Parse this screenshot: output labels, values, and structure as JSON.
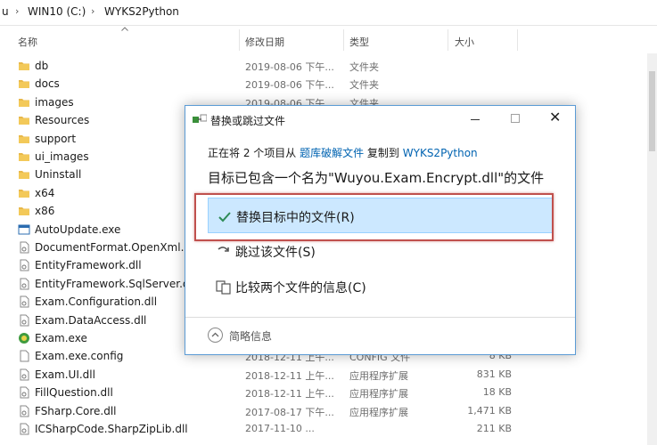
{
  "breadcrumb": {
    "items": [
      "u",
      "WIN10 (C:)",
      "WYKS2Python"
    ]
  },
  "columns": {
    "name": "名称",
    "date": "修改日期",
    "type": "类型",
    "size": "大小"
  },
  "files": [
    {
      "name": "db",
      "date": "2019-08-06 下午...",
      "type": "文件夹",
      "size": "",
      "icon": "folder-icon"
    },
    {
      "name": "docs",
      "date": "2019-08-06 下午...",
      "type": "文件夹",
      "size": "",
      "icon": "folder-icon"
    },
    {
      "name": "images",
      "date": "2019-08-06 下午...",
      "type": "文件夹",
      "size": "",
      "icon": "folder-icon"
    },
    {
      "name": "Resources",
      "date": "",
      "type": "",
      "size": "",
      "icon": "folder-icon"
    },
    {
      "name": "support",
      "date": "",
      "type": "",
      "size": "",
      "icon": "folder-icon"
    },
    {
      "name": "ui_images",
      "date": "",
      "type": "",
      "size": "",
      "icon": "folder-icon"
    },
    {
      "name": "Uninstall",
      "date": "",
      "type": "",
      "size": "",
      "icon": "folder-icon"
    },
    {
      "name": "x64",
      "date": "",
      "type": "",
      "size": "",
      "icon": "folder-icon"
    },
    {
      "name": "x86",
      "date": "",
      "type": "",
      "size": "",
      "icon": "folder-icon"
    },
    {
      "name": "AutoUpdate.exe",
      "date": "",
      "type": "",
      "size": "",
      "icon": "exe-icon"
    },
    {
      "name": "DocumentFormat.OpenXml.dll",
      "date": "",
      "type": "",
      "size": "",
      "icon": "dll-icon"
    },
    {
      "name": "EntityFramework.dll",
      "date": "",
      "type": "",
      "size": "",
      "icon": "dll-icon"
    },
    {
      "name": "EntityFramework.SqlServer.dll",
      "date": "",
      "type": "",
      "size": "",
      "icon": "dll-icon"
    },
    {
      "name": "Exam.Configuration.dll",
      "date": "",
      "type": "",
      "size": "",
      "icon": "dll-icon"
    },
    {
      "name": "Exam.DataAccess.dll",
      "date": "",
      "type": "",
      "size": "",
      "icon": "dll-icon"
    },
    {
      "name": "Exam.exe",
      "date": "",
      "type": "",
      "size": "",
      "icon": "exam-app-icon"
    },
    {
      "name": "Exam.exe.config",
      "date": "2018-12-11 上午...",
      "type": "CONFIG 文件",
      "size": "8 KB",
      "icon": "config-file-icon"
    },
    {
      "name": "Exam.UI.dll",
      "date": "2018-12-11 上午...",
      "type": "应用程序扩展",
      "size": "831 KB",
      "icon": "dll-icon"
    },
    {
      "name": "FillQuestion.dll",
      "date": "2018-12-11 上午...",
      "type": "应用程序扩展",
      "size": "18 KB",
      "icon": "dll-icon"
    },
    {
      "name": "FSharp.Core.dll",
      "date": "2017-08-17 下午...",
      "type": "应用程序扩展",
      "size": "1,471 KB",
      "icon": "dll-icon"
    },
    {
      "name": "ICSharpCode.SharpZipLib.dll",
      "date": "2017-11-10 ...",
      "type": "",
      "size": "211 KB",
      "icon": "dll-icon"
    }
  ],
  "dialog": {
    "title": "替换或跳过文件",
    "close_glyph": "✕",
    "info": {
      "prefix": "正在将 2 个项目从 ",
      "source": "题库破解文件",
      "middle": " 复制到 ",
      "dest": "WYKS2Python"
    },
    "heading": "目标已包含一个名为\"Wuyou.Exam.Encrypt.dll\"的文件",
    "options": {
      "replace": "替换目标中的文件(R)",
      "skip": "跳过该文件(S)",
      "compare": "比较两个文件的信息(C)"
    },
    "details": "简略信息"
  },
  "colors": {
    "accent": "#0063b1",
    "selected_bg": "#cce8ff",
    "highlight_border": "#c0504d",
    "folder": "#e8b84a",
    "check": "#2e8b57"
  }
}
